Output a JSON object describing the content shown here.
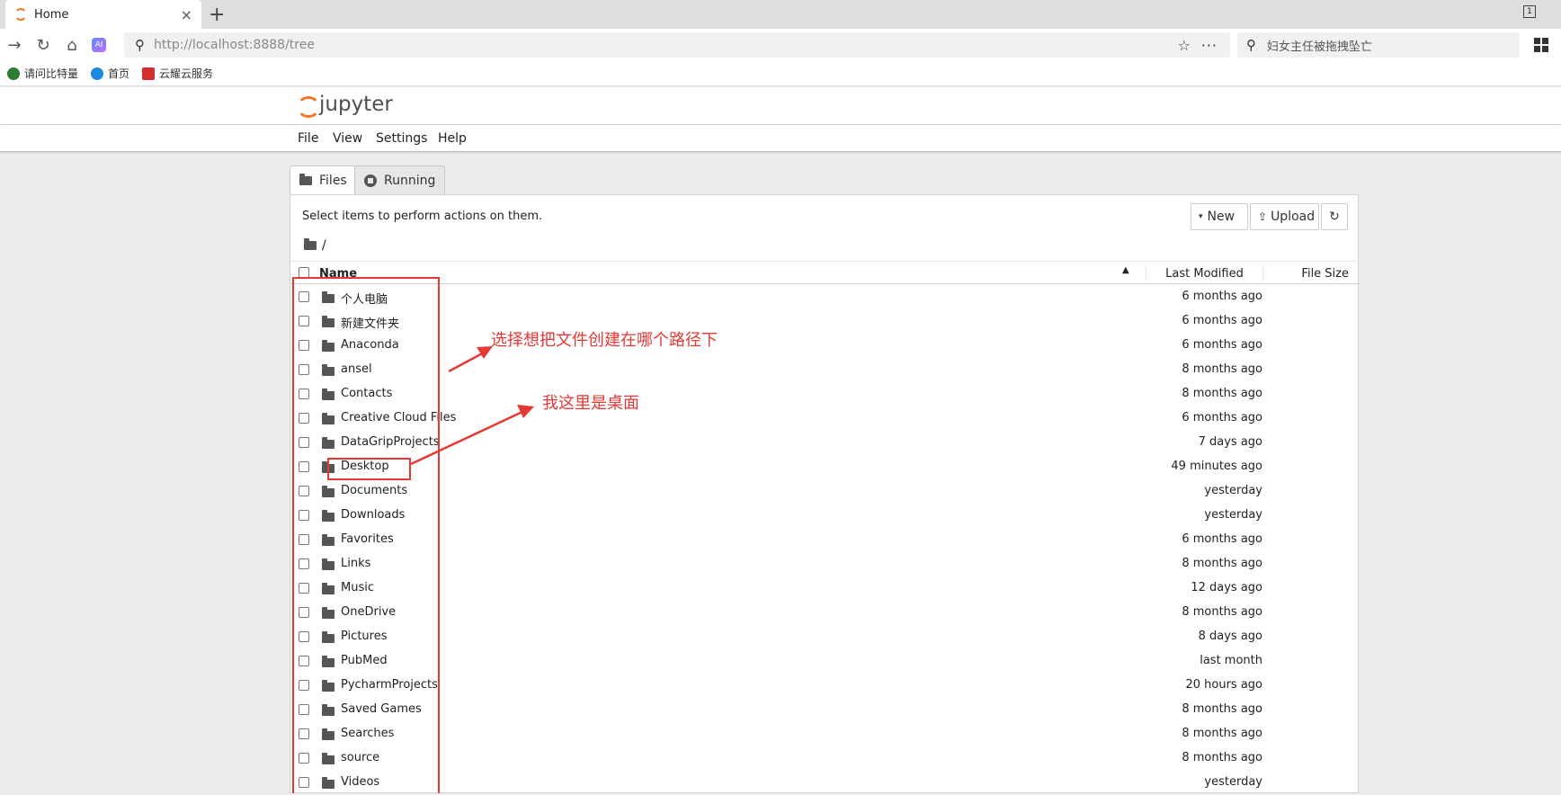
{
  "browser": {
    "tab_title": "Home",
    "tab_close": "×",
    "new_tab": "+",
    "window_badge": "1",
    "url": "http://localhost:8888/tree",
    "search_text": "妇女主任被拖拽坠亡",
    "bookmarks": [
      {
        "label": "请问比特量",
        "color": "#2e7d32"
      },
      {
        "label": "首页",
        "color": "#1e88e5"
      },
      {
        "label": "云耀云服务",
        "color": "#d32f2f"
      }
    ]
  },
  "jupyter": {
    "logo_text": "jupyter",
    "menu": [
      "File",
      "View",
      "Settings",
      "Help"
    ],
    "tabs": {
      "files": "Files",
      "running": "Running"
    },
    "select_hint": "Select items to perform actions on them.",
    "buttons": {
      "new": "New",
      "upload": "Upload",
      "refresh": "↻"
    },
    "breadcrumb": "/",
    "columns": {
      "name": "Name",
      "last_modified": "Last Modified",
      "file_size": "File Size"
    },
    "items": [
      {
        "name": "个人电脑",
        "modified": "6 months ago"
      },
      {
        "name": "新建文件夹",
        "modified": "6 months ago"
      },
      {
        "name": "Anaconda",
        "modified": "6 months ago"
      },
      {
        "name": "ansel",
        "modified": "8 months ago"
      },
      {
        "name": "Contacts",
        "modified": "8 months ago"
      },
      {
        "name": "Creative Cloud Files",
        "modified": "6 months ago"
      },
      {
        "name": "DataGripProjects",
        "modified": "7 days ago"
      },
      {
        "name": "Desktop",
        "modified": "49 minutes ago"
      },
      {
        "name": "Documents",
        "modified": "yesterday"
      },
      {
        "name": "Downloads",
        "modified": "yesterday"
      },
      {
        "name": "Favorites",
        "modified": "6 months ago"
      },
      {
        "name": "Links",
        "modified": "8 months ago"
      },
      {
        "name": "Music",
        "modified": "12 days ago"
      },
      {
        "name": "OneDrive",
        "modified": "8 months ago"
      },
      {
        "name": "Pictures",
        "modified": "8 days ago"
      },
      {
        "name": "PubMed",
        "modified": "last month"
      },
      {
        "name": "PycharmProjects",
        "modified": "20 hours ago"
      },
      {
        "name": "Saved Games",
        "modified": "8 months ago"
      },
      {
        "name": "Searches",
        "modified": "8 months ago"
      },
      {
        "name": "source",
        "modified": "8 months ago"
      },
      {
        "name": "Videos",
        "modified": "yesterday"
      }
    ]
  },
  "annotations": {
    "note_path": "选择想把文件创建在哪个路径下",
    "note_desktop": "我这里是桌面",
    "color": "#e53935"
  }
}
